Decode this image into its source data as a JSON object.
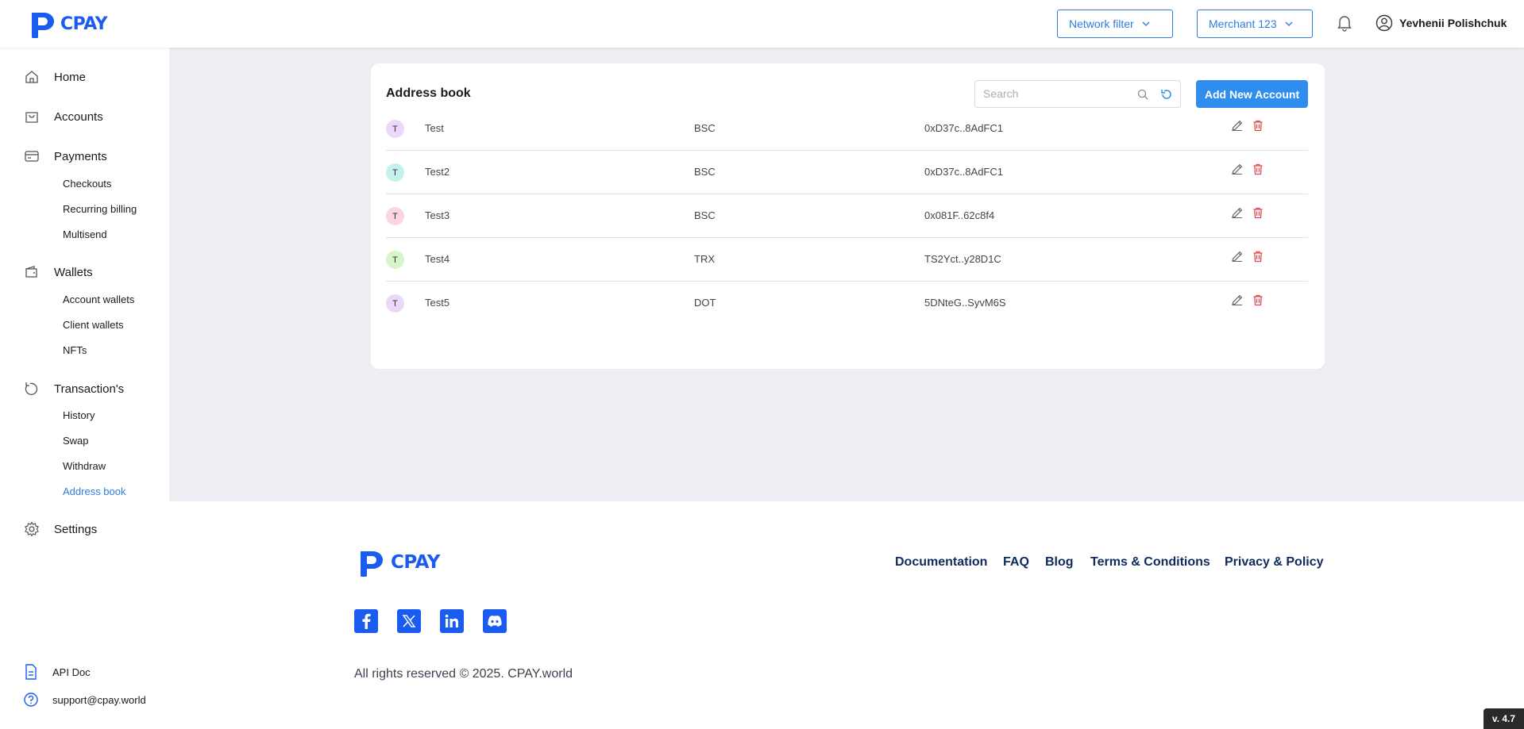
{
  "app": {
    "name": "CPAY"
  },
  "header": {
    "network_filter": "Network filter",
    "merchant": "Merchant 123",
    "user_name": "Yevhenii Polishchuk"
  },
  "sidebar": {
    "home": "Home",
    "accounts": "Accounts",
    "payments": "Payments",
    "checkouts": "Checkouts",
    "recurring_billing": "Recurring billing",
    "multisend": "Multisend",
    "wallets": "Wallets",
    "account_wallets": "Account wallets",
    "client_wallets": "Client wallets",
    "nfts": "NFTs",
    "transactions": "Transaction's",
    "history": "History",
    "swap": "Swap",
    "withdraw": "Withdraw",
    "address_book": "Address book",
    "settings": "Settings",
    "api_doc": "API Doc",
    "support": "support@cpay.world"
  },
  "address_book": {
    "title": "Address book",
    "search_placeholder": "Search",
    "add_button": "Add New Account",
    "rows": [
      {
        "initial": "T",
        "name": "Test",
        "network": "BSC",
        "address": "0xD37c..8AdFC1",
        "avatar_color": "#ead9fb"
      },
      {
        "initial": "T",
        "name": "Test2",
        "network": "BSC",
        "address": "0xD37c..8AdFC1",
        "avatar_color": "#c4f1ec"
      },
      {
        "initial": "T",
        "name": "Test3",
        "network": "BSC",
        "address": "0x081F..62c8f4",
        "avatar_color": "#fbd5e6"
      },
      {
        "initial": "T",
        "name": "Test4",
        "network": "TRX",
        "address": "TS2Yct..y28D1C",
        "avatar_color": "#d6f5c9"
      },
      {
        "initial": "T",
        "name": "Test5",
        "network": "DOT",
        "address": "5DNteG..SyvM6S",
        "avatar_color": "#ead9fb"
      }
    ]
  },
  "footer": {
    "documentation": "Documentation",
    "faq": "FAQ",
    "blog": "Blog",
    "terms": "Terms & Conditions",
    "privacy": "Privacy & Policy",
    "copyright": "All rights reserved © 2025. CPAY.world"
  },
  "version": "v. 4.7",
  "colors": {
    "accent": "#2f8df0",
    "brand": "#1a5cf0",
    "active": "#2f7de1",
    "delete": "#e5484d"
  }
}
